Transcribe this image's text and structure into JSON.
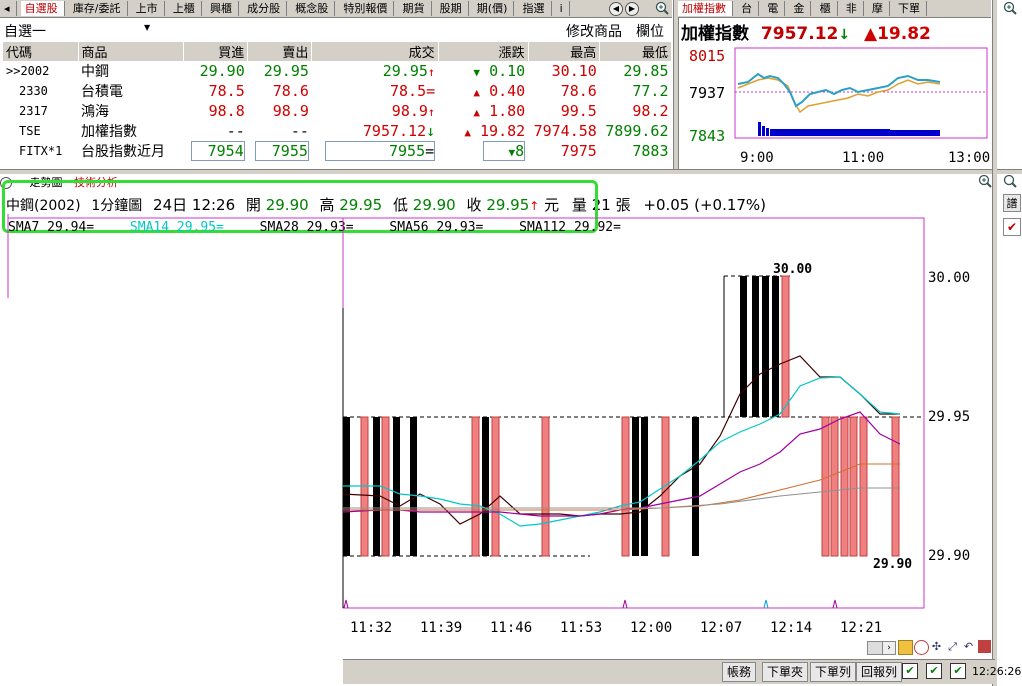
{
  "top_tabs": [
    "自選股",
    "庫存/委託",
    "上市",
    "上櫃",
    "興櫃",
    "成分股",
    "概念股",
    "特別報價",
    "期貨",
    "股期",
    "期(價)",
    "指選",
    "i"
  ],
  "index_tabs": [
    "加權指數",
    "台",
    "電",
    "金",
    "櫃",
    "非",
    "摩",
    "下單"
  ],
  "watchlist": {
    "name": "自選一",
    "modify_label": "修改商品",
    "fields_label": "欄位"
  },
  "quote_headers": [
    "代碼",
    "商品",
    "買進",
    "賣出",
    "成交",
    "漲跌",
    "最高",
    "最低"
  ],
  "quotes": [
    {
      "code": ">>2002",
      "name": "中鋼",
      "bid": "29.90",
      "ask": "29.95",
      "last": "29.95",
      "last_mark": "↑",
      "chg_mark": "▼",
      "chg": "0.10",
      "high": "30.10",
      "low": "29.85"
    },
    {
      "code": "2330",
      "name": "台積電",
      "bid": "78.5",
      "ask": "78.6",
      "last": "78.5",
      "last_mark": "=",
      "chg_mark": "▲",
      "chg": "0.40",
      "high": "78.6",
      "low": "77.2"
    },
    {
      "code": "2317",
      "name": "鴻海",
      "bid": "98.8",
      "ask": "98.9",
      "last": "98.9",
      "last_mark": "↑",
      "chg_mark": "▲",
      "chg": "1.80",
      "high": "99.5",
      "low": "98.2"
    },
    {
      "code": "TSE",
      "name": "加權指數",
      "bid": "--",
      "ask": "--",
      "last": "7957.12",
      "last_mark": "↓",
      "chg_mark": "▲",
      "chg": "19.82",
      "high": "7974.58",
      "low": "7899.62"
    },
    {
      "code": "FITX*1",
      "name": "台股指數近月",
      "bid": "7954",
      "ask": "7955",
      "last": "7955",
      "last_mark": "=",
      "chg_mark": "▼",
      "chg": "8",
      "high": "7975",
      "low": "7883"
    }
  ],
  "index_panel": {
    "title": "加權指數",
    "value": "7957.12",
    "value_mark": "↓",
    "change_mark": "▲",
    "change": "19.82",
    "y_ticks": [
      "8015",
      "7937",
      "7843"
    ],
    "x_ticks": [
      "9:00",
      "11:00",
      "13:00"
    ]
  },
  "chart_tabs": [
    "走勢圖",
    "技術分析"
  ],
  "chart_header": {
    "stock": "中鋼(2002)",
    "period": "1分鐘圖",
    "datetime": "24日 12:26",
    "open_label": "開",
    "open": "29.90",
    "high_label": "高",
    "high": "29.95",
    "low_label": "低",
    "low": "29.90",
    "close_label": "收",
    "close": "29.95",
    "close_mark": "↑",
    "unit": "元",
    "volume_label": "量",
    "volume": "21",
    "volume_unit": "張",
    "change": "+0.05 (+0.17%)"
  },
  "ma_legend": [
    {
      "label": "SMA7 29.94=",
      "color": "#000000"
    },
    {
      "label": "SMA14 29.95=",
      "color": "#00c8c8"
    },
    {
      "label": "SMA28 29.93=",
      "color": "#000000"
    },
    {
      "label": "SMA56 29.93=",
      "color": "#000000"
    },
    {
      "label": "SMA112 29.92=",
      "color": "#000000"
    }
  ],
  "kline": {
    "y_ticks": [
      "30.00",
      "29.95",
      "29.90"
    ],
    "x_ticks": [
      "11:32",
      "11:39",
      "11:46",
      "11:53",
      "12:00",
      "12:07",
      "12:14",
      "12:21"
    ],
    "max_label": "30.00",
    "min_label": "29.90"
  },
  "status_buttons": [
    "帳務",
    "下單夾",
    "下單列",
    "回報列"
  ],
  "clock": "12:26:26",
  "colors": {
    "up": "#d00000",
    "down": "#008000",
    "bull_candle": "#f08080",
    "bear_candle": "#000000",
    "ma_cyan": "#00c8c8",
    "ma_purple": "#a000a0",
    "highlight": "#33dd33"
  },
  "chart_data": {
    "type": "line",
    "title": "加權指數",
    "ylim": [
      7843,
      8015
    ],
    "x_ticks": [
      "9:00",
      "11:00",
      "13:00"
    ]
  }
}
